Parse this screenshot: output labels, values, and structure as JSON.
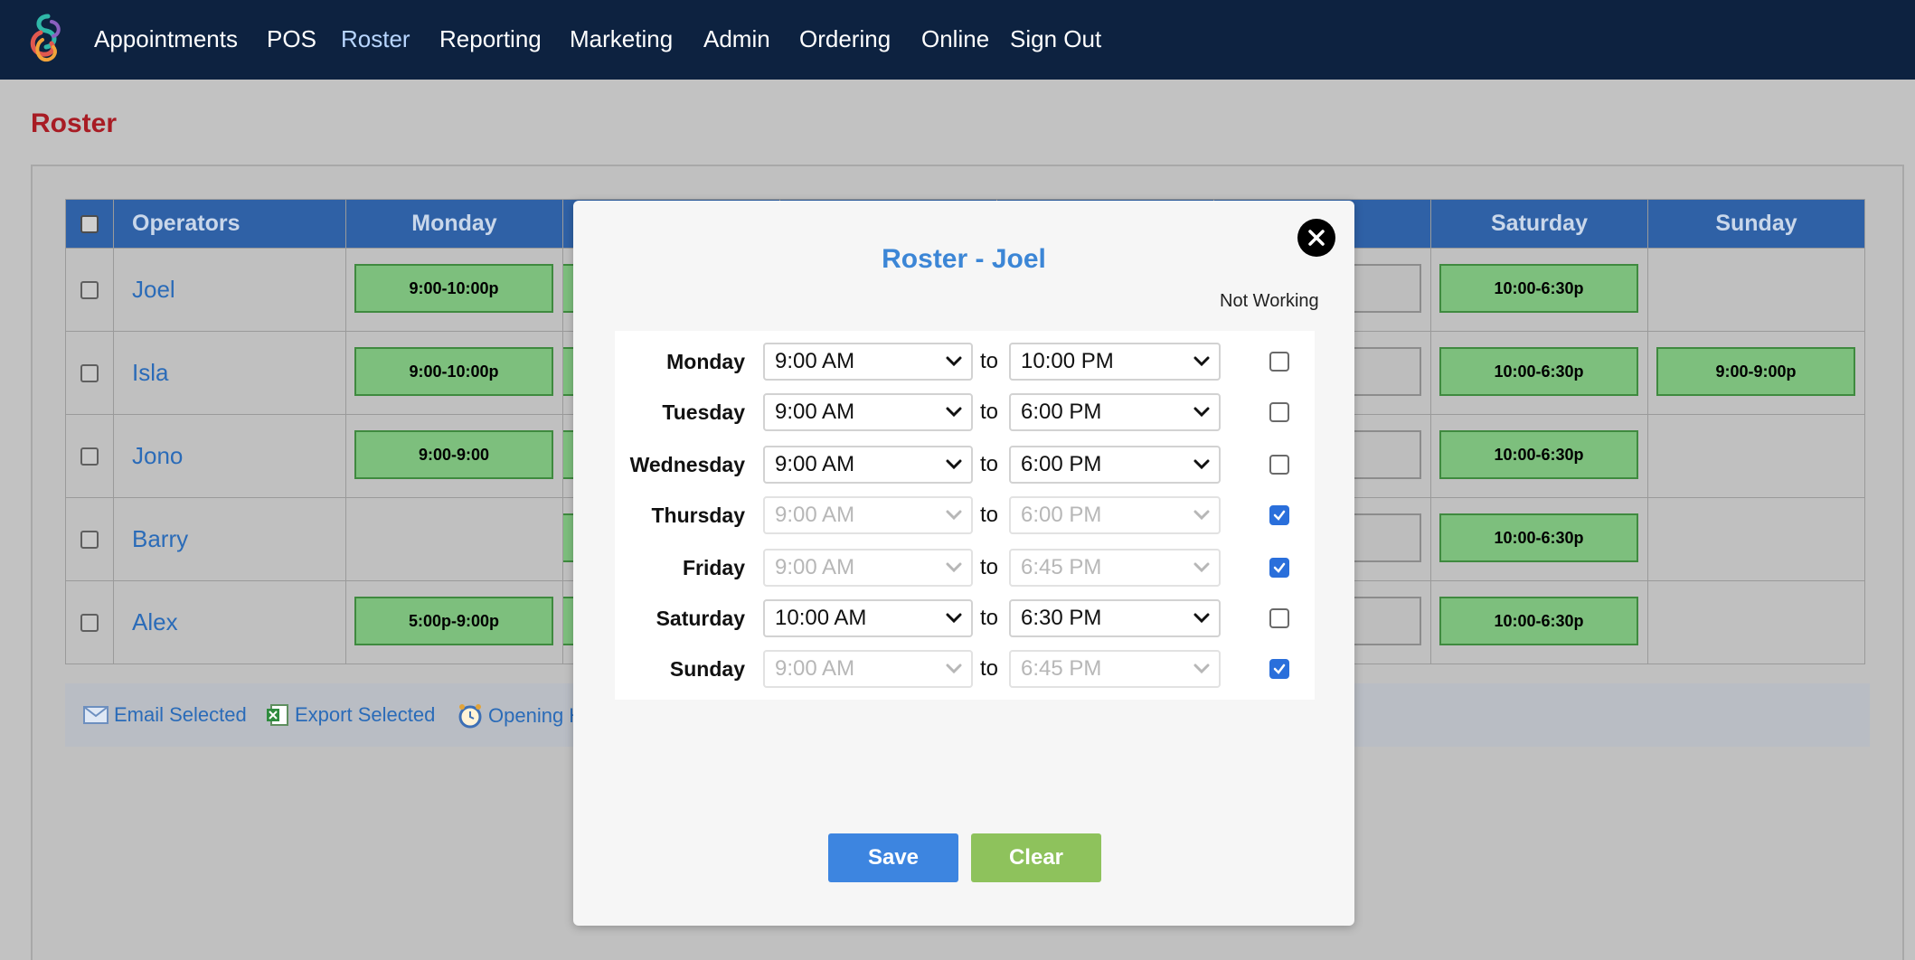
{
  "nav": {
    "items": [
      {
        "label": "Appointments"
      },
      {
        "label": "POS"
      },
      {
        "label": "Roster"
      },
      {
        "label": "Reporting"
      },
      {
        "label": "Marketing"
      },
      {
        "label": "Admin"
      },
      {
        "label": "Ordering"
      },
      {
        "label": "Online"
      },
      {
        "label": "Sign Out"
      }
    ],
    "active": "Roster"
  },
  "page": {
    "title": "Roster"
  },
  "table": {
    "headers": {
      "operators": "Operators",
      "monday": "Monday",
      "saturday": "Saturday",
      "sunday": "Sunday"
    },
    "rows": [
      {
        "name": "Joel",
        "monday": "9:00-10:00p",
        "saturday": "10:00-6:30p",
        "sunday": ""
      },
      {
        "name": "Isla",
        "monday": "9:00-10:00p",
        "saturday": "10:00-6:30p",
        "sunday": "9:00-9:00p"
      },
      {
        "name": "Jono",
        "monday": "9:00-9:00",
        "saturday": "10:00-6:30p",
        "sunday": ""
      },
      {
        "name": "Barry",
        "monday": "",
        "saturday": "10:00-6:30p",
        "sunday": ""
      },
      {
        "name": "Alex",
        "monday": "5:00p-9:00p",
        "saturday": "10:00-6:30p",
        "sunday": ""
      }
    ]
  },
  "actions": {
    "email": "Email Selected",
    "export": "Export Selected",
    "opening": "Opening H"
  },
  "modal": {
    "title": "Roster - Joel",
    "not_working_label": "Not Working",
    "to_word": "to",
    "days": [
      {
        "day": "Monday",
        "from": "9:00 AM",
        "to": "10:00 PM",
        "not_working": false
      },
      {
        "day": "Tuesday",
        "from": "9:00 AM",
        "to": "6:00 PM",
        "not_working": false
      },
      {
        "day": "Wednesday",
        "from": "9:00 AM",
        "to": "6:00 PM",
        "not_working": false
      },
      {
        "day": "Thursday",
        "from": "9:00 AM",
        "to": "6:00 PM",
        "not_working": true
      },
      {
        "day": "Friday",
        "from": "9:00 AM",
        "to": "6:45 PM",
        "not_working": true
      },
      {
        "day": "Saturday",
        "from": "10:00 AM",
        "to": "6:30 PM",
        "not_working": false
      },
      {
        "day": "Sunday",
        "from": "9:00 AM",
        "to": "6:45 PM",
        "not_working": true
      }
    ],
    "save_label": "Save",
    "clear_label": "Clear"
  },
  "colors": {
    "nav_bg": "#0d2240",
    "title_red": "#a81c24",
    "header_blue": "#2f61a6",
    "shift_green": "#7dbf7d",
    "link_blue": "#2a6bb8",
    "save_blue": "#3d85e0",
    "clear_green": "#8ec25c",
    "checkbox_blue": "#2a6fdb"
  }
}
